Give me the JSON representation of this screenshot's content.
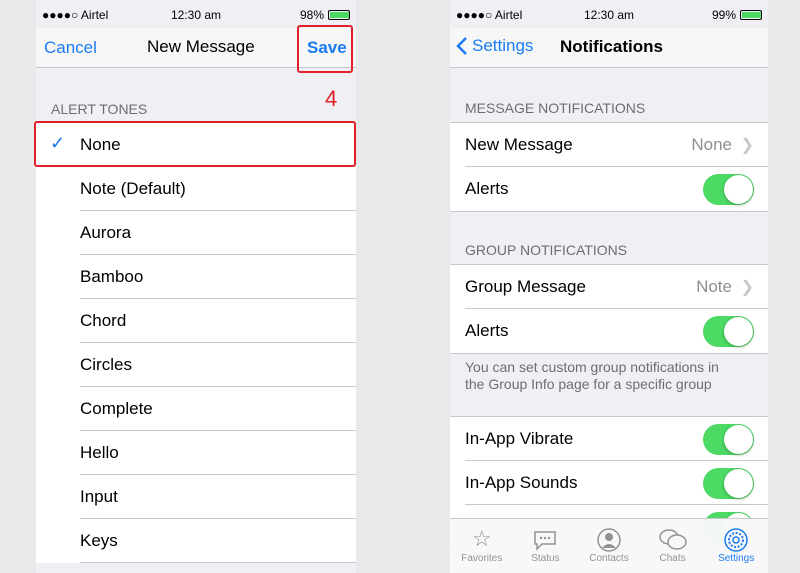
{
  "left": {
    "status": {
      "carrier": "●●●●○ Airtel",
      "time": "12:30 am",
      "battery": "98%"
    },
    "nav": {
      "cancel": "Cancel",
      "title": "New Message",
      "save": "Save"
    },
    "annotation": "4",
    "section": "ALERT TONES",
    "check": "✓",
    "tones": [
      "None",
      "Note (Default)",
      "Aurora",
      "Bamboo",
      "Chord",
      "Circles",
      "Complete",
      "Hello",
      "Input",
      "Keys"
    ]
  },
  "right": {
    "status": {
      "carrier": "●●●●○ Airtel",
      "time": "12:30 am",
      "battery": "99%"
    },
    "nav": {
      "back": "Settings",
      "title": "Notifications"
    },
    "msg_section": "MESSAGE NOTIFICATIONS",
    "new_message": {
      "label": "New Message",
      "value": "None"
    },
    "alerts1": "Alerts",
    "group_section": "GROUP NOTIFICATIONS",
    "group_message": {
      "label": "Group Message",
      "value": "Note"
    },
    "alerts2": "Alerts",
    "footnote": "You can set custom group notifications in the Group Info page for a specific group",
    "inapp_vibrate": "In-App Vibrate",
    "inapp_sounds": "In-App Sounds",
    "tabs": [
      {
        "label": "Favorites",
        "icon": "star-icon"
      },
      {
        "label": "Status",
        "icon": "speech-bubble-icon"
      },
      {
        "label": "Contacts",
        "icon": "contact-icon"
      },
      {
        "label": "Chats",
        "icon": "chats-icon"
      },
      {
        "label": "Settings",
        "icon": "gear-icon"
      }
    ]
  },
  "colors": {
    "accent": "#1a7cf2",
    "switch_on": "#4cd964",
    "annotation": "#e0202a"
  }
}
